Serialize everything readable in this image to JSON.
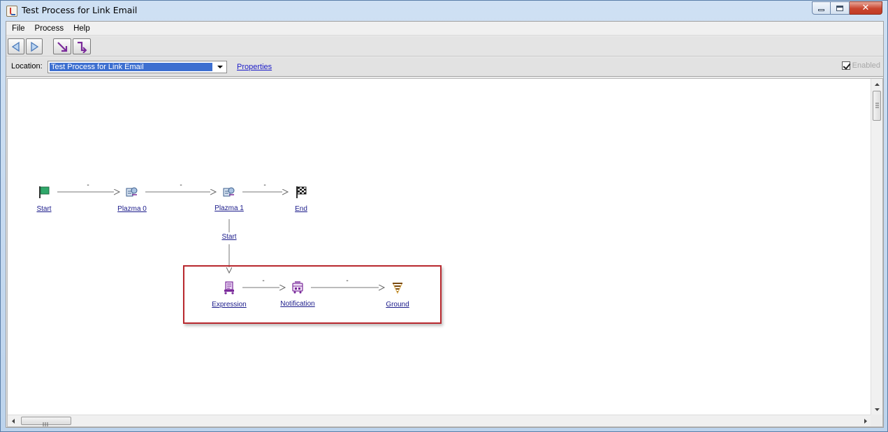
{
  "window": {
    "title": "Test Process for Link Email",
    "controls": {
      "close_glyph": "✕"
    }
  },
  "menubar": {
    "items": [
      {
        "label": "File"
      },
      {
        "label": "Process"
      },
      {
        "label": "Help"
      }
    ]
  },
  "toolbar": {
    "buttons": [
      {
        "icon": "back-arrow-icon"
      },
      {
        "icon": "forward-arrow-icon"
      },
      {
        "icon": "diagonal-connector-icon"
      },
      {
        "icon": "elbow-connector-icon"
      }
    ]
  },
  "location": {
    "label": "Location:",
    "value": "Test Process for Link Email",
    "properties_link": "Properties",
    "enabled_label": "Enabled",
    "enabled_checked": true
  },
  "diagram": {
    "nodes": [
      {
        "id": "start",
        "label": "Start",
        "icon": "green-flag-icon"
      },
      {
        "id": "plazma0",
        "label": "Plazma 0",
        "icon": "plazma-icon"
      },
      {
        "id": "plazma1",
        "label": "Plazma 1",
        "icon": "plazma-icon"
      },
      {
        "id": "end",
        "label": "End",
        "icon": "checkered-flag-icon"
      },
      {
        "id": "expression",
        "label": "Expression",
        "icon": "expression-icon"
      },
      {
        "id": "notification",
        "label": "Notification",
        "icon": "notification-icon"
      },
      {
        "id": "ground",
        "label": "Ground",
        "icon": "ground-icon"
      }
    ],
    "edges": [
      {
        "from": "start",
        "to": "plazma0",
        "label": "-"
      },
      {
        "from": "plazma0",
        "to": "plazma1",
        "label": "-"
      },
      {
        "from": "plazma1",
        "to": "end",
        "label": "-"
      },
      {
        "from": "plazma1",
        "to": "expression",
        "label": "Start"
      },
      {
        "from": "expression",
        "to": "notification",
        "label": "-"
      },
      {
        "from": "notification",
        "to": "ground",
        "label": "-"
      }
    ],
    "highlight_color": "#b8282e"
  },
  "colors": {
    "link": "#1a1ac8",
    "selection": "#3d6fd0",
    "accent_purple": "#7a2a9a"
  }
}
